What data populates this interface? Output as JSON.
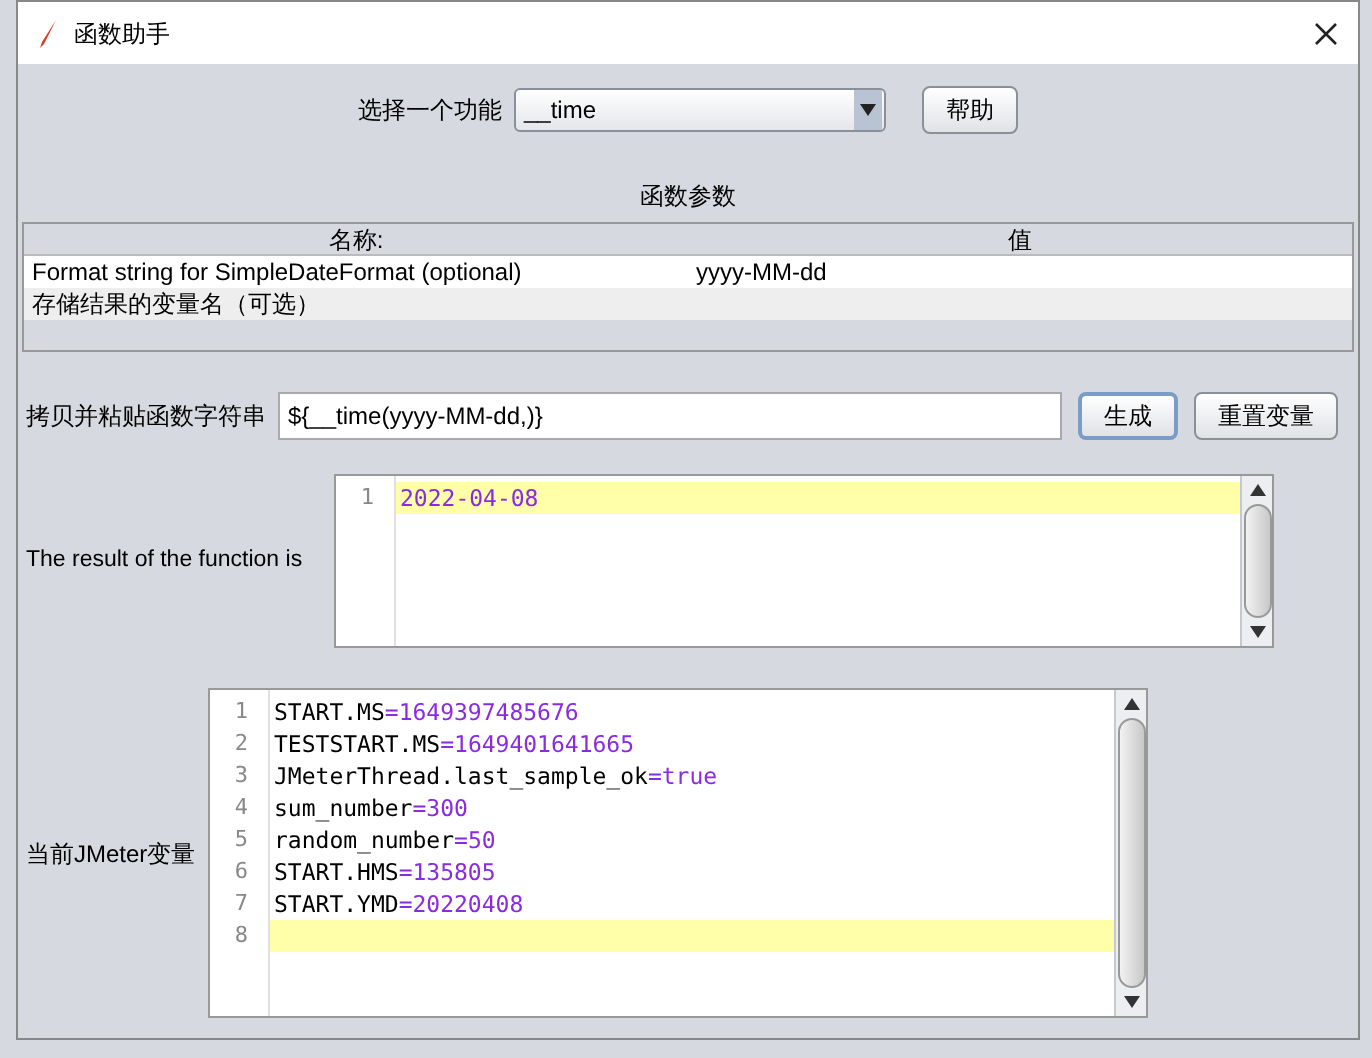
{
  "window": {
    "title": "函数助手"
  },
  "function_select": {
    "label": "选择一个功能",
    "value": "__time",
    "help_button": "帮助"
  },
  "parameters": {
    "title": "函数参数",
    "columns": [
      "名称:",
      "值"
    ],
    "rows": [
      {
        "name": "Format string for SimpleDateFormat (optional)",
        "value": "yyyy-MM-dd"
      },
      {
        "name": "存储结果的变量名（可选）",
        "value": ""
      }
    ]
  },
  "copy_row": {
    "label": "拷贝并粘贴函数字符串",
    "value": "${__time(yyyy-MM-dd,)}",
    "generate_button": "生成",
    "reset_button": "重置变量"
  },
  "result": {
    "label": "The result of the function is",
    "lines": [
      {
        "line": "1",
        "text": "2022-04-08",
        "current": true
      }
    ]
  },
  "variables": {
    "label": "当前JMeter变量",
    "lines": [
      {
        "line": "1",
        "name": "START.MS",
        "value": "=1649397485676",
        "current": false
      },
      {
        "line": "2",
        "name": "TESTSTART.MS",
        "value": "=1649401641665",
        "current": false
      },
      {
        "line": "3",
        "name": "JMeterThread.last_sample_ok",
        "value": "=true",
        "current": false
      },
      {
        "line": "4",
        "name": "sum_number",
        "value": "=300",
        "current": false
      },
      {
        "line": "5",
        "name": "random_number",
        "value": "=50",
        "current": false
      },
      {
        "line": "6",
        "name": "START.HMS",
        "value": "=135805",
        "current": false
      },
      {
        "line": "7",
        "name": "START.YMD",
        "value": "=20220408",
        "current": false
      },
      {
        "line": "8",
        "current": true
      }
    ]
  }
}
